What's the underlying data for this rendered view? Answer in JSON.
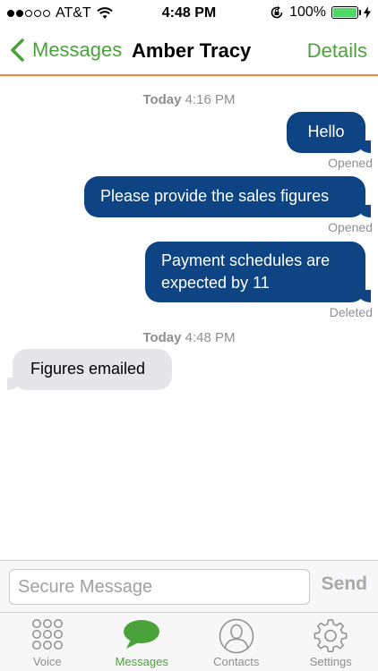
{
  "status_bar": {
    "carrier": "AT&T",
    "time": "4:48 PM",
    "battery": "100%",
    "battery_level": 1.0,
    "signal_bars_filled": 2,
    "signal_bars_total": 5
  },
  "nav": {
    "back_label": "Messages",
    "title": "Amber Tracy",
    "details_label": "Details"
  },
  "thread": {
    "timestamps": [
      {
        "day": "Today",
        "time": "4:16 PM"
      },
      {
        "day": "Today",
        "time": "4:48 PM"
      }
    ],
    "messages": [
      {
        "direction": "outgoing",
        "text": "Hello",
        "status": "Opened"
      },
      {
        "direction": "outgoing",
        "text": "Please provide the sales figures",
        "status": "Opened"
      },
      {
        "direction": "outgoing",
        "text": "Payment schedules are expected by 11",
        "status": "Deleted"
      },
      {
        "direction": "incoming",
        "text": "Figures emailed",
        "status": ""
      }
    ]
  },
  "composer": {
    "placeholder": "Secure Message",
    "value": "",
    "send_label": "Send"
  },
  "tabs": [
    {
      "label": "Voice",
      "icon": "voice-keypad-icon",
      "active": false
    },
    {
      "label": "Messages",
      "icon": "chat-bubble-icon",
      "active": true
    },
    {
      "label": "Contacts",
      "icon": "contact-person-icon",
      "active": false
    },
    {
      "label": "Settings",
      "icon": "gear-icon",
      "active": false
    }
  ],
  "colors": {
    "accent": "#4aa33a",
    "nav_divider": "#f2893a",
    "outgoing_bubble": "#0e4484",
    "incoming_bubble": "#e5e5ea",
    "battery_fill": "#4cd964"
  }
}
